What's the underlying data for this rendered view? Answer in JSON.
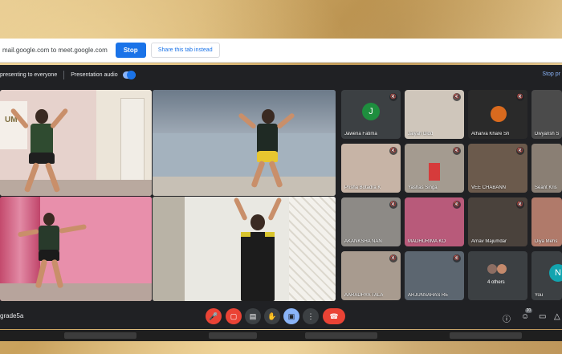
{
  "share_bar": {
    "message": "mail.google.com to meet.google.com",
    "stop_label": "Stop",
    "hide_label": "Share this tab instead"
  },
  "present_bar": {
    "presenting_label": "presenting to everyone",
    "audio_label": "Presentation audio",
    "stop_label": "Stop pr"
  },
  "participants": [
    {
      "name": "Jaweria Fatima",
      "initial": "J",
      "avatar_color": "#1e8e3e"
    },
    {
      "name": "Jaiyah Didd"
    },
    {
      "name": "Atharva Khare Sh"
    },
    {
      "name": "Divyansh S"
    },
    {
      "name": "Prisha Botadra K"
    },
    {
      "name": "Yashas Singa"
    },
    {
      "name": "VEE CHABANN"
    },
    {
      "name": "Seant Kris"
    },
    {
      "name": "AKANKSHA NAN"
    },
    {
      "name": "MADHURIMA KO"
    },
    {
      "name": "Arnav Majumdar"
    },
    {
      "name": "Diya Mehs"
    },
    {
      "name": "AARADHYA TALA"
    },
    {
      "name": "ARJUNSAHAS RE"
    }
  ],
  "others_label": "4 others",
  "you_label": "You",
  "you_initial": "N",
  "meeting_name": "grade5a",
  "participants_count": "20",
  "poster_text": "UM"
}
